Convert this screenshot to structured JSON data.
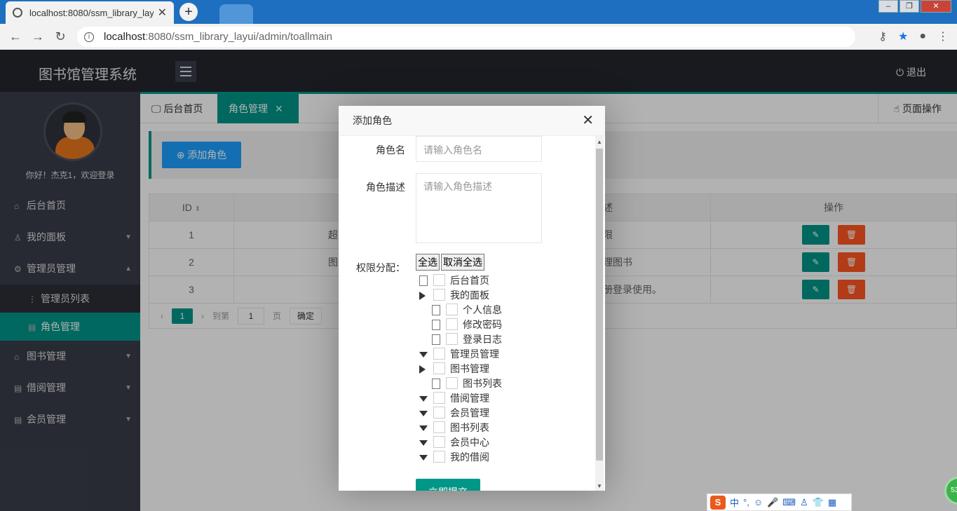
{
  "browser": {
    "tab_title": "localhost:8080/ssm_library_lay",
    "tab_close": "✕",
    "new_tab": "+",
    "url_host": "localhost",
    "url_rest": ":8080/ssm_library_layui/admin/toallmain"
  },
  "header": {
    "app_title": "图书馆管理系统",
    "logout": "⏻ 退出"
  },
  "sidebar": {
    "greeting": "你好！杰克1，欢迎登录",
    "items": [
      {
        "label": "后台首页",
        "icon": "home-icon"
      },
      {
        "label": "我的面板",
        "icon": "user-icon"
      },
      {
        "label": "管理员管理",
        "icon": "gear-icon"
      },
      {
        "label": "图书管理",
        "icon": "home-icon"
      },
      {
        "label": "借阅管理",
        "icon": "doc-icon"
      },
      {
        "label": "会员管理",
        "icon": "doc-icon"
      }
    ],
    "sub_items": [
      {
        "label": "管理员列表"
      },
      {
        "label": "角色管理"
      }
    ]
  },
  "tabs": {
    "home": "后台首页",
    "role": "角色管理",
    "page_ops": "页面操作"
  },
  "toolbar": {
    "add_role": "添加角色"
  },
  "table": {
    "headers": [
      "ID",
      "",
      "述",
      "操作"
    ],
    "rows": [
      {
        "id": "1",
        "name": "超",
        "desc": "限"
      },
      {
        "id": "2",
        "name": "图",
        "desc": "理图书"
      },
      {
        "id": "3",
        "name": "",
        "desc": "册登录使用。"
      }
    ]
  },
  "pager": {
    "current": "1",
    "goto": "到第",
    "page_input": "1",
    "page": "页",
    "confirm": "确定"
  },
  "modal": {
    "title": "添加角色",
    "role_name_label": "角色名",
    "role_name_placeholder": "请输入角色名",
    "role_desc_label": "角色描述",
    "role_desc_placeholder": "请输入角色描述",
    "perm_label": "权限分配：",
    "select_all": "全选",
    "deselect_all": "取消全选",
    "tree": [
      {
        "label": "后台首页",
        "level": 0,
        "type": "doc"
      },
      {
        "label": "我的面板",
        "level": 0,
        "type": "right"
      },
      {
        "label": "个人信息",
        "level": 1,
        "type": "doc"
      },
      {
        "label": "修改密码",
        "level": 1,
        "type": "doc"
      },
      {
        "label": "登录日志",
        "level": 1,
        "type": "doc"
      },
      {
        "label": "管理员管理",
        "level": 0,
        "type": "down"
      },
      {
        "label": "图书管理",
        "level": 0,
        "type": "right"
      },
      {
        "label": "图书列表",
        "level": 1,
        "type": "doc"
      },
      {
        "label": "借阅管理",
        "level": 0,
        "type": "down"
      },
      {
        "label": "会员管理",
        "level": 0,
        "type": "down"
      },
      {
        "label": "图书列表",
        "level": 0,
        "type": "down"
      },
      {
        "label": "会员中心",
        "level": 0,
        "type": "down"
      },
      {
        "label": "我的借阅",
        "level": 0,
        "type": "down"
      }
    ],
    "submit": "立即提交"
  },
  "ime": {
    "lang": "中",
    "punct": "°,",
    "ball": "53"
  },
  "colors": {
    "accent": "#009688",
    "blue": "#1e9fff",
    "danger": "#ff5722",
    "header": "#23262e",
    "sidebar": "#393d49"
  }
}
